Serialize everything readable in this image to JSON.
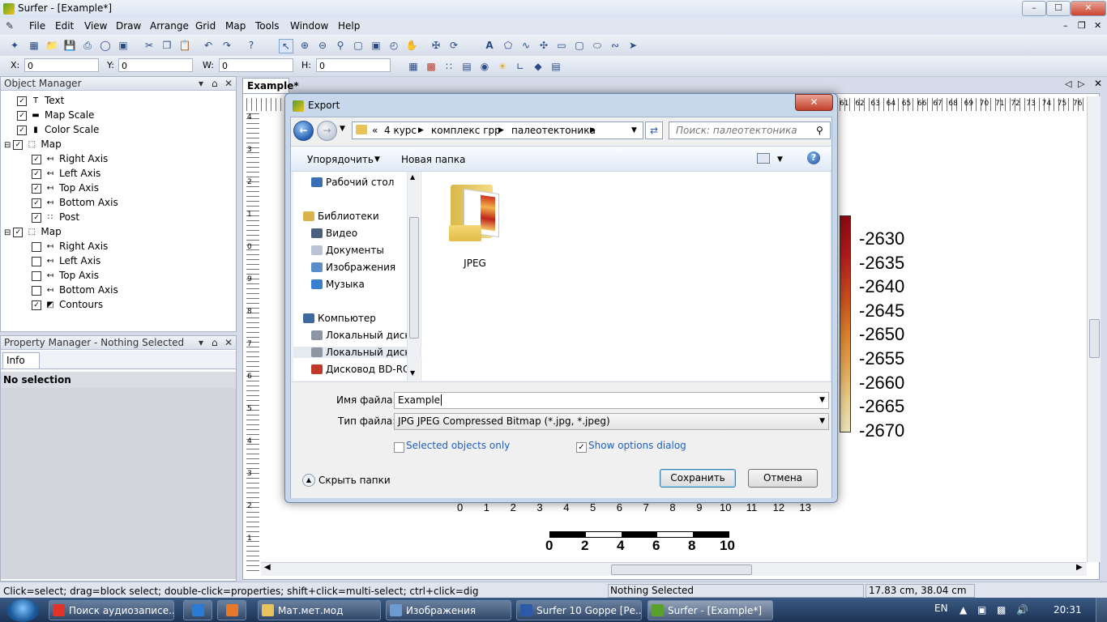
{
  "window": {
    "title": "Surfer - [Example*]",
    "min": "–",
    "max": "☐",
    "close": "✕"
  },
  "menu": [
    "File",
    "Edit",
    "View",
    "Draw",
    "Arrange",
    "Grid",
    "Map",
    "Tools",
    "Window",
    "Help"
  ],
  "coords": {
    "x_label": "X:",
    "x_value": "0",
    "y_label": "Y:",
    "y_value": "0",
    "w_label": "W:",
    "w_value": "0",
    "h_label": "H:",
    "h_value": "0"
  },
  "object_manager": {
    "title": "Object Manager",
    "items": [
      {
        "label": "Text",
        "checked": true,
        "indent": 1,
        "icon": "text-icon"
      },
      {
        "label": "Map Scale",
        "checked": true,
        "indent": 1,
        "icon": "map-scale-icon"
      },
      {
        "label": "Color Scale",
        "checked": true,
        "indent": 1,
        "icon": "color-scale-icon"
      },
      {
        "label": "Map",
        "checked": true,
        "indent": 0,
        "icon": "map-icon"
      },
      {
        "label": "Right Axis",
        "checked": true,
        "indent": 2,
        "icon": "axis-icon"
      },
      {
        "label": "Left Axis",
        "checked": true,
        "indent": 2,
        "icon": "axis-icon"
      },
      {
        "label": "Top Axis",
        "checked": true,
        "indent": 2,
        "icon": "axis-icon"
      },
      {
        "label": "Bottom Axis",
        "checked": true,
        "indent": 2,
        "icon": "axis-icon"
      },
      {
        "label": "Post",
        "checked": true,
        "indent": 2,
        "icon": "post-icon"
      },
      {
        "label": "Map",
        "checked": true,
        "indent": 0,
        "icon": "map-icon"
      },
      {
        "label": "Right Axis",
        "checked": false,
        "indent": 2,
        "icon": "axis-icon"
      },
      {
        "label": "Left Axis",
        "checked": false,
        "indent": 2,
        "icon": "axis-icon"
      },
      {
        "label": "Top Axis",
        "checked": false,
        "indent": 2,
        "icon": "axis-icon"
      },
      {
        "label": "Bottom Axis",
        "checked": false,
        "indent": 2,
        "icon": "axis-icon"
      },
      {
        "label": "Contours",
        "checked": true,
        "indent": 2,
        "icon": "contours-icon"
      }
    ]
  },
  "property_manager": {
    "title": "Property Manager - Nothing Selected",
    "tab": "Info",
    "no_selection": "No selection"
  },
  "doc_tab": "Example*",
  "plot": {
    "color_scale_labels": [
      "-2630",
      "-2635",
      "-2640",
      "-2645",
      "-2650",
      "-2655",
      "-2660",
      "-2665",
      "-2670"
    ],
    "bottom_ticks": [
      "0",
      "1",
      "2",
      "3",
      "4",
      "5",
      "6",
      "7",
      "8",
      "9",
      "10",
      "11",
      "12",
      "13"
    ],
    "scale_bar_labels": [
      "0",
      "2",
      "4",
      "6",
      "8",
      "10"
    ],
    "top_ruler_labels": [
      "61",
      "62",
      "63",
      "64",
      "65",
      "66",
      "67",
      "68",
      "69",
      "70",
      "71",
      "72",
      "73",
      "74",
      "75",
      "76"
    ],
    "left_ruler_labels": [
      "4",
      "3",
      "2",
      "1",
      "0",
      "9",
      "8",
      "7",
      "6",
      "5",
      "4",
      "3",
      "2",
      "1"
    ]
  },
  "status": {
    "hint": "Click=select; drag=block select; double-click=properties; shift+click=multi-select; ctrl+click=dig",
    "selection": "Nothing Selected",
    "position": "17.83 cm, 38.04 cm"
  },
  "dialog": {
    "title": "Export",
    "breadcrumb": [
      "«",
      "4 курс",
      "комплекс грр",
      "палеотектоника"
    ],
    "search_placeholder": "Поиск: палеотектоника",
    "organize": "Упорядочить",
    "new_folder": "Новая папка",
    "nav": [
      {
        "label": "Рабочий стол",
        "indent": 1,
        "icon": "desktop-icon",
        "color": "#3a6fb5"
      },
      {
        "label": "Библиотеки",
        "indent": 0,
        "icon": "libraries-icon",
        "color": "#d8b44a"
      },
      {
        "label": "Видео",
        "indent": 1,
        "icon": "video-icon",
        "color": "#4b5f7e"
      },
      {
        "label": "Документы",
        "indent": 1,
        "icon": "documents-icon",
        "color": "#b9c4d3"
      },
      {
        "label": "Изображения",
        "indent": 1,
        "icon": "pictures-icon",
        "color": "#5b8ec9"
      },
      {
        "label": "Музыка",
        "indent": 1,
        "icon": "music-icon",
        "color": "#3b7fd1"
      },
      {
        "label": "Компьютер",
        "indent": 0,
        "icon": "computer-icon",
        "color": "#3e6a9f"
      },
      {
        "label": "Локальный диск",
        "indent": 1,
        "icon": "drive-icon",
        "color": "#8d96a3"
      },
      {
        "label": "Локальный диск",
        "indent": 1,
        "icon": "drive-icon",
        "color": "#8d96a3"
      },
      {
        "label": "Дисковод BD-RO",
        "indent": 1,
        "icon": "optical-drive-icon",
        "color": "#c0392b"
      }
    ],
    "folder_name": "JPEG",
    "filename_label": "Имя файла:",
    "filename_value": "Example",
    "filetype_label": "Тип файла:",
    "filetype_value": "JPG JPEG Compressed Bitmap (*.jpg, *.jpeg)",
    "selected_only": "Selected objects only",
    "show_options": "Show options dialog",
    "hide_folders": "Скрыть папки",
    "save": "Сохранить",
    "cancel": "Отмена"
  },
  "taskbar": {
    "items": [
      {
        "label": "Поиск аудиозаписе...",
        "color": "#e0342a"
      },
      {
        "label": "",
        "color": "#2a7bd3"
      },
      {
        "label": "",
        "color": "#e8782a"
      },
      {
        "label": "Мат.мет.мод",
        "color": "#e8c25a"
      },
      {
        "label": "Изображения",
        "color": "#6d9bd1"
      },
      {
        "label": "Surfer 10 Goppe [Ре...",
        "color": "#2b5ba8"
      },
      {
        "label": "Surfer - [Example*]",
        "color": "#5aa02c"
      }
    ],
    "lang": "EN",
    "time": "20:31"
  }
}
